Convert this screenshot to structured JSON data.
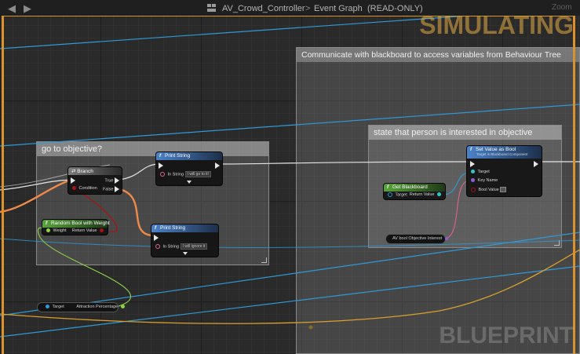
{
  "titlebar": {
    "back_icon": "back-arrow-icon",
    "forward_icon": "forward-arrow-icon",
    "asset_name": "AV_Crowd_Controller",
    "separator": ">",
    "graph_name": "Event Graph",
    "readonly": "(READ-ONLY)",
    "zoom": "Zoom"
  },
  "watermarks": {
    "simulating": "SIMULATING",
    "blueprint": "BLUEPRINT"
  },
  "comments": {
    "blackboard": "Communicate with blackboard to access variables from Behaviour Tree",
    "objective": "go to objective?",
    "interested": "state that person is interested in objective"
  },
  "nodes": {
    "branch": {
      "title": "Branch",
      "condition": "Condition",
      "true": "True",
      "false": "False"
    },
    "print_top": {
      "title": "Print String",
      "in_string": "In String",
      "value": "I will go to it!"
    },
    "print_bottom": {
      "title": "Print String",
      "in_string": "In String",
      "value": "I will ignore it"
    },
    "random_bool": {
      "title": "Random Bool with Weight",
      "weight": "Weight",
      "return": "Return Value"
    },
    "get_blackboard": {
      "title": "Get Blackboard",
      "target": "Target",
      "return": "Return Value"
    },
    "set_value": {
      "title": "Set Value as Bool",
      "subtitle": "Target is Blackboard Component",
      "target": "Target",
      "key_name": "Key Name",
      "bool_value": "Bool Value"
    },
    "av_bool": {
      "label": "AV bool Objective Interest"
    },
    "attraction": {
      "target": "Target",
      "label": "Attraction Percentage"
    }
  },
  "colors": {
    "simulating_border": "#d9922c",
    "exec_wire": "#e6e6e6",
    "bool_wire": "#a11",
    "float_wire": "#8ed24a",
    "object_wire": "#2f9ad6",
    "name_wire": "#e06292",
    "active_wire": "#f08a4b"
  }
}
